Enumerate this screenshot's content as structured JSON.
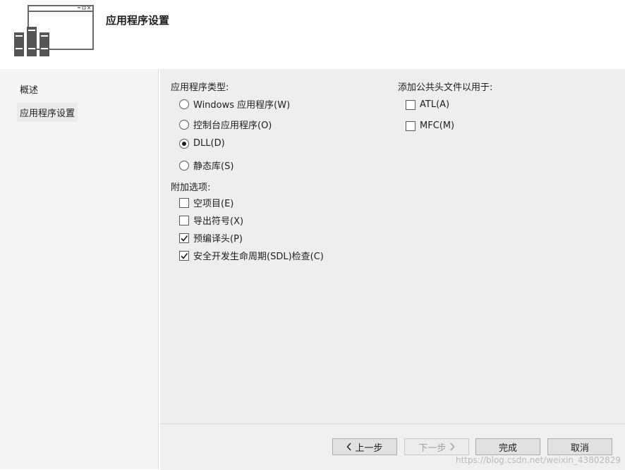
{
  "header": {
    "title": "应用程序设置",
    "icon": "app-settings-window-icon"
  },
  "sidebar": {
    "items": [
      {
        "label": "概述",
        "selected": false
      },
      {
        "label": "应用程序设置",
        "selected": true
      }
    ]
  },
  "app_type": {
    "label": "应用程序类型:",
    "options": [
      {
        "label": "Windows 应用程序(W)",
        "selected": false
      },
      {
        "label": "控制台应用程序(O)",
        "selected": false
      },
      {
        "label": "DLL(D)",
        "selected": true
      },
      {
        "label": "静态库(S)",
        "selected": false
      }
    ]
  },
  "additional": {
    "label": "附加选项:",
    "options": [
      {
        "label": "空项目(E)",
        "checked": false
      },
      {
        "label": "导出符号(X)",
        "checked": false
      },
      {
        "label": "预编译头(P)",
        "checked": true
      },
      {
        "label": "安全开发生命周期(SDL)检查(C)",
        "checked": true
      }
    ]
  },
  "common_headers": {
    "label": "添加公共头文件以用于:",
    "options": [
      {
        "label": "ATL(A)",
        "checked": false
      },
      {
        "label": "MFC(M)",
        "checked": false
      }
    ]
  },
  "footer": {
    "prev": {
      "label": "上一步",
      "icon": "chevron-left-icon",
      "enabled": true
    },
    "next": {
      "label": "下一步",
      "icon": "chevron-right-icon",
      "enabled": false
    },
    "finish": {
      "label": "完成"
    },
    "cancel": {
      "label": "取消"
    }
  },
  "watermark": "https://blog.csdn.net/weixin_43802829",
  "colors": {
    "main_bg": "#eeeeee",
    "sidebar_bg": "#f5f5f5",
    "icon_gray": "#555555"
  }
}
